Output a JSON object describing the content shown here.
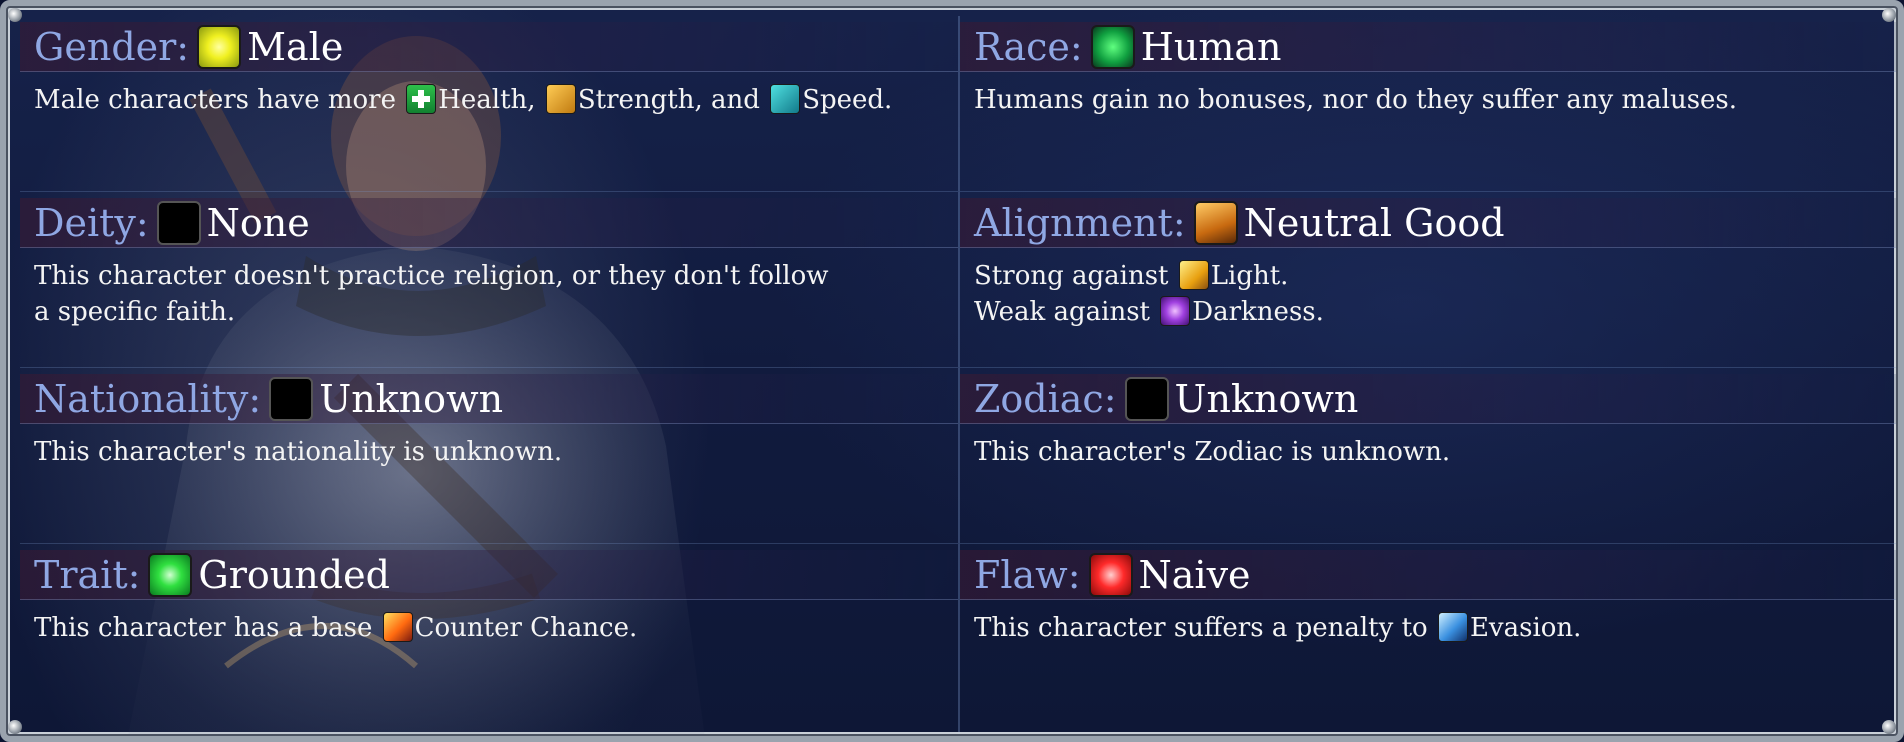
{
  "cells": [
    {
      "label": "Gender:",
      "icon": "gender-male-icon",
      "value": "Male",
      "desc": {
        "pre": "Male characters have more ",
        "i1": "Health,",
        "mid1": " ",
        "i2": "Strength,",
        "mid2": " and ",
        "i3": "Speed."
      }
    },
    {
      "label": "Race:",
      "icon": "race-human-icon",
      "value": "Human",
      "desc": {
        "line1": "Humans gain no bonuses, nor do they suffer any maluses."
      }
    },
    {
      "label": "Deity:",
      "icon": "empty-icon",
      "value": "None",
      "desc": {
        "line1": "This character doesn't practice religion, or they don't follow",
        "line2": "a specific faith."
      }
    },
    {
      "label": "Alignment:",
      "icon": "shield-icon",
      "value": "Neutral Good",
      "desc": {
        "line1_pre": "Strong against ",
        "line1_term": "Light.",
        "line2_pre": "Weak against ",
        "line2_term": "Darkness."
      }
    },
    {
      "label": "Nationality:",
      "icon": "empty-icon",
      "value": "Unknown",
      "desc": {
        "line1": "This character's nationality is unknown."
      }
    },
    {
      "label": "Zodiac:",
      "icon": "empty-icon",
      "value": "Unknown",
      "desc": {
        "line1": "This character's Zodiac is unknown."
      }
    },
    {
      "label": "Trait:",
      "icon": "green-orb-icon",
      "value": "Grounded",
      "desc": {
        "pre": "This character has a base ",
        "term": "Counter Chance."
      }
    },
    {
      "label": "Flaw:",
      "icon": "red-gem-icon",
      "value": "Naive",
      "desc": {
        "pre": "This character suffers a penalty to ",
        "term": "Evasion."
      }
    }
  ],
  "colors": {
    "label": "#8fa7e3",
    "value": "#ffffff",
    "text": "#f4f4f4",
    "frame": "#9aa3ae",
    "background": "#111b3e"
  }
}
